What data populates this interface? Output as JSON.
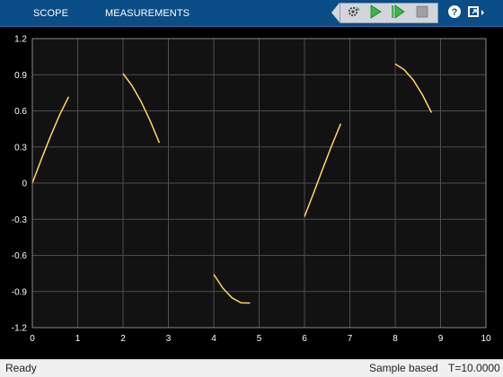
{
  "toolbar": {
    "tabs": [
      {
        "label": "SCOPE"
      },
      {
        "label": "MEASUREMENTS"
      }
    ],
    "buttons": [
      {
        "icon": "settings-icon"
      },
      {
        "icon": "run-icon"
      },
      {
        "icon": "step-forward-icon"
      },
      {
        "icon": "stop-icon"
      },
      {
        "icon": "help-icon"
      },
      {
        "icon": "undock-icon"
      }
    ]
  },
  "status": {
    "state": "Ready",
    "mode": "Sample based",
    "time": "T=10.0000"
  },
  "colors": {
    "toolbar": "#0b4d86",
    "plot_background": "#000000",
    "axes_background": "#121212",
    "grid": "#4d4d4d",
    "tick_text": "#ffffff",
    "signal": "#ffd75f",
    "run_green": "#3bb54a",
    "stop_gray": "#a0a0a0"
  },
  "chart_data": {
    "type": "line",
    "title": "",
    "xlabel": "",
    "ylabel": "",
    "xlim": [
      0,
      10
    ],
    "ylim": [
      -1.2,
      1.2
    ],
    "xticks": [
      "0",
      "1",
      "2",
      "3",
      "4",
      "5",
      "6",
      "7",
      "8",
      "9",
      "10"
    ],
    "yticks": [
      "1.2",
      "0.9",
      "0.6",
      "0.3",
      "0",
      "-0.3",
      "-0.6",
      "-0.9",
      "-1.2"
    ],
    "grid": true,
    "legend": "none",
    "series": [
      {
        "segments": [
          {
            "x": [
              0,
              0.2,
              0.4,
              0.6,
              0.8
            ],
            "y": [
              0,
              0.199,
              0.389,
              0.565,
              0.717
            ]
          },
          {
            "x": [
              2,
              2.2,
              2.4,
              2.6,
              2.8
            ],
            "y": [
              0.909,
              0.808,
              0.675,
              0.516,
              0.335
            ]
          },
          {
            "x": [
              4,
              4.2,
              4.4,
              4.6,
              4.8
            ],
            "y": [
              -0.757,
              -0.872,
              -0.952,
              -0.994,
              -0.996
            ]
          },
          {
            "x": [
              6,
              6.2,
              6.4,
              6.6,
              6.8
            ],
            "y": [
              -0.279,
              -0.083,
              0.117,
              0.312,
              0.494
            ]
          },
          {
            "x": [
              8,
              8.2,
              8.4,
              8.6,
              8.8
            ],
            "y": [
              0.989,
              0.941,
              0.855,
              0.734,
              0.585
            ]
          }
        ]
      }
    ]
  }
}
